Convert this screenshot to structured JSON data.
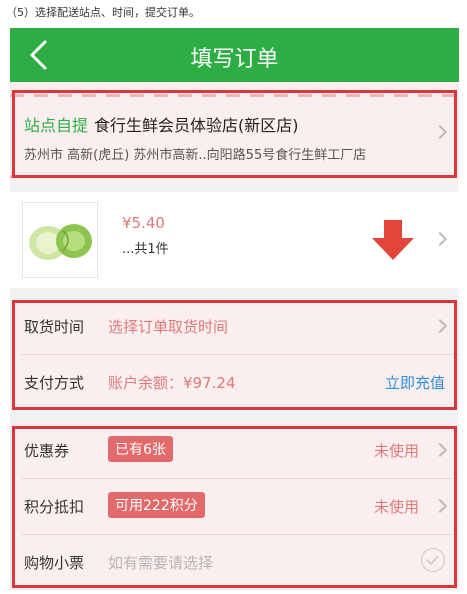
{
  "caption": "（5）选择配送站点、时间，提交订单。",
  "navbar": {
    "title": "填写订单",
    "back_icon": "chevron-left-icon"
  },
  "station": {
    "tag": "站点自提",
    "name": "食行生鲜会员体验店(新区店)",
    "address": "苏州市 高新(虎丘) 苏州市高新..向阳路55号食行生鲜工厂店"
  },
  "product": {
    "price": "¥5.40",
    "quantity": "...共1件",
    "arrow_color": "#e2453a"
  },
  "pickup": {
    "label": "取货时间",
    "value": "选择订单取货时间"
  },
  "payment": {
    "label": "支付方式",
    "value": "账户余额：¥97.24",
    "action": "立即充值"
  },
  "coupon": {
    "label": "优惠券",
    "badge": "已有6张",
    "status": "未使用"
  },
  "points": {
    "label": "积分抵扣",
    "badge": "可用222积分",
    "status": "未使用"
  },
  "receipt": {
    "label": "购物小票",
    "placeholder": "如有需要请选择"
  },
  "colors": {
    "brand_green": "#2cae45",
    "highlight_red": "#d9363e",
    "price_red": "#e07a7a",
    "link_blue": "#2b8fd6"
  }
}
